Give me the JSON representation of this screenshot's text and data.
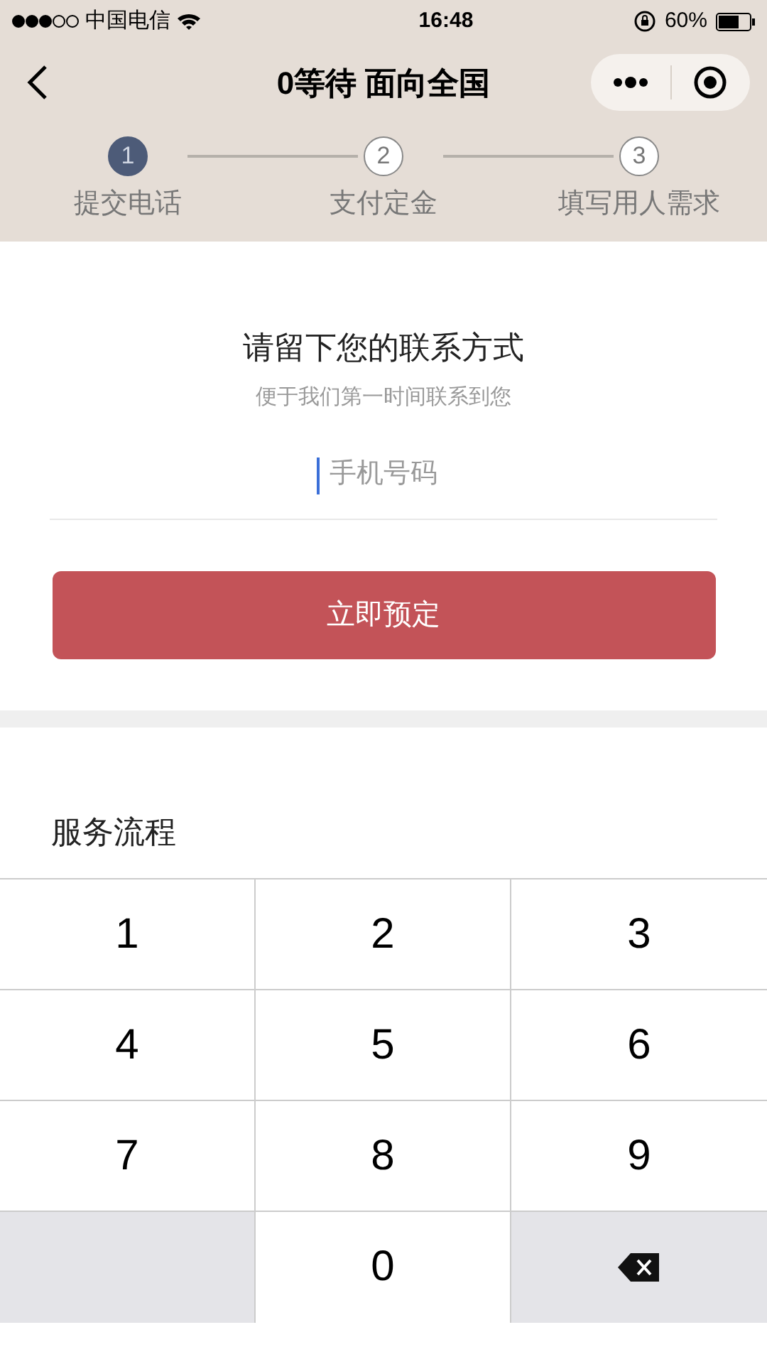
{
  "status_bar": {
    "carrier": "中国电信",
    "time": "16:48",
    "battery": "60%"
  },
  "nav": {
    "title": "0等待 面向全国"
  },
  "steps": [
    {
      "number": "1",
      "label": "提交电话",
      "selected": true
    },
    {
      "number": "2",
      "label": "支付定金",
      "selected": false
    },
    {
      "number": "3",
      "label": "填写用人需求",
      "selected": false
    }
  ],
  "form": {
    "heading": "请留下您的联系方式",
    "subheading": "便于我们第一时间联系到您",
    "placeholder": "手机号码",
    "button": "立即预定"
  },
  "section_title": "服务流程",
  "keypad": [
    {
      "kind": "digit",
      "label": "1"
    },
    {
      "kind": "digit",
      "label": "2"
    },
    {
      "kind": "digit",
      "label": "3"
    },
    {
      "kind": "digit",
      "label": "4"
    },
    {
      "kind": "digit",
      "label": "5"
    },
    {
      "kind": "digit",
      "label": "6"
    },
    {
      "kind": "digit",
      "label": "7"
    },
    {
      "kind": "digit",
      "label": "8"
    },
    {
      "kind": "digit",
      "label": "9"
    },
    {
      "kind": "blank"
    },
    {
      "kind": "digit",
      "label": "0"
    },
    {
      "kind": "delete"
    }
  ]
}
